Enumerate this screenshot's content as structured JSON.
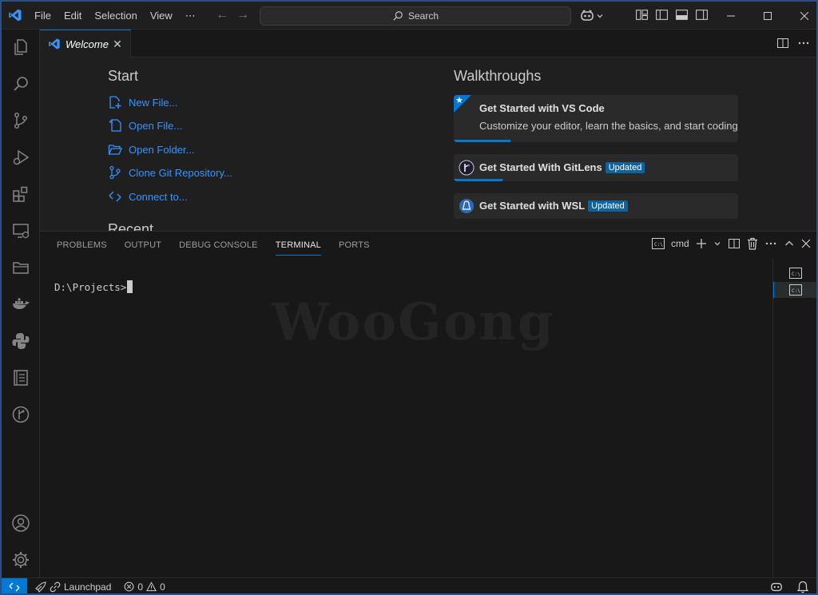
{
  "window": {
    "menu": [
      "File",
      "Edit",
      "Selection",
      "View",
      "⋯"
    ],
    "search_label": "Search"
  },
  "tab": {
    "label": "Welcome"
  },
  "welcome": {
    "start_heading": "Start",
    "start_items": [
      {
        "label": "New File...",
        "icon": "new-file-icon"
      },
      {
        "label": "Open File...",
        "icon": "open-file-icon"
      },
      {
        "label": "Open Folder...",
        "icon": "open-folder-icon"
      },
      {
        "label": "Clone Git Repository...",
        "icon": "source-control-icon"
      },
      {
        "label": "Connect to...",
        "icon": "remote-icon"
      }
    ],
    "recent_heading": "Recent",
    "walkthroughs_heading": "Walkthroughs",
    "walkthroughs": [
      {
        "title": "Get Started with VS Code",
        "description": "Customize your editor, learn the basics, and start coding",
        "badge": "",
        "progress": 0.2
      },
      {
        "title": "Get Started With GitLens",
        "description": "",
        "badge": "Updated",
        "progress": 0.17
      },
      {
        "title": "Get Started with WSL",
        "description": "",
        "badge": "Updated",
        "progress": 0
      }
    ]
  },
  "panel": {
    "tabs": [
      "PROBLEMS",
      "OUTPUT",
      "DEBUG CONSOLE",
      "TERMINAL",
      "PORTS"
    ],
    "active_tab": "TERMINAL",
    "terminal_name": "cmd",
    "prompt": "D:\\Projects>",
    "watermark": "WooGong"
  },
  "statusbar": {
    "launchpad": "Launchpad",
    "errors": "0",
    "warnings": "0"
  },
  "colors": {
    "accent": "#0078d4",
    "link": "#3794ff",
    "badge": "#0e639c"
  }
}
